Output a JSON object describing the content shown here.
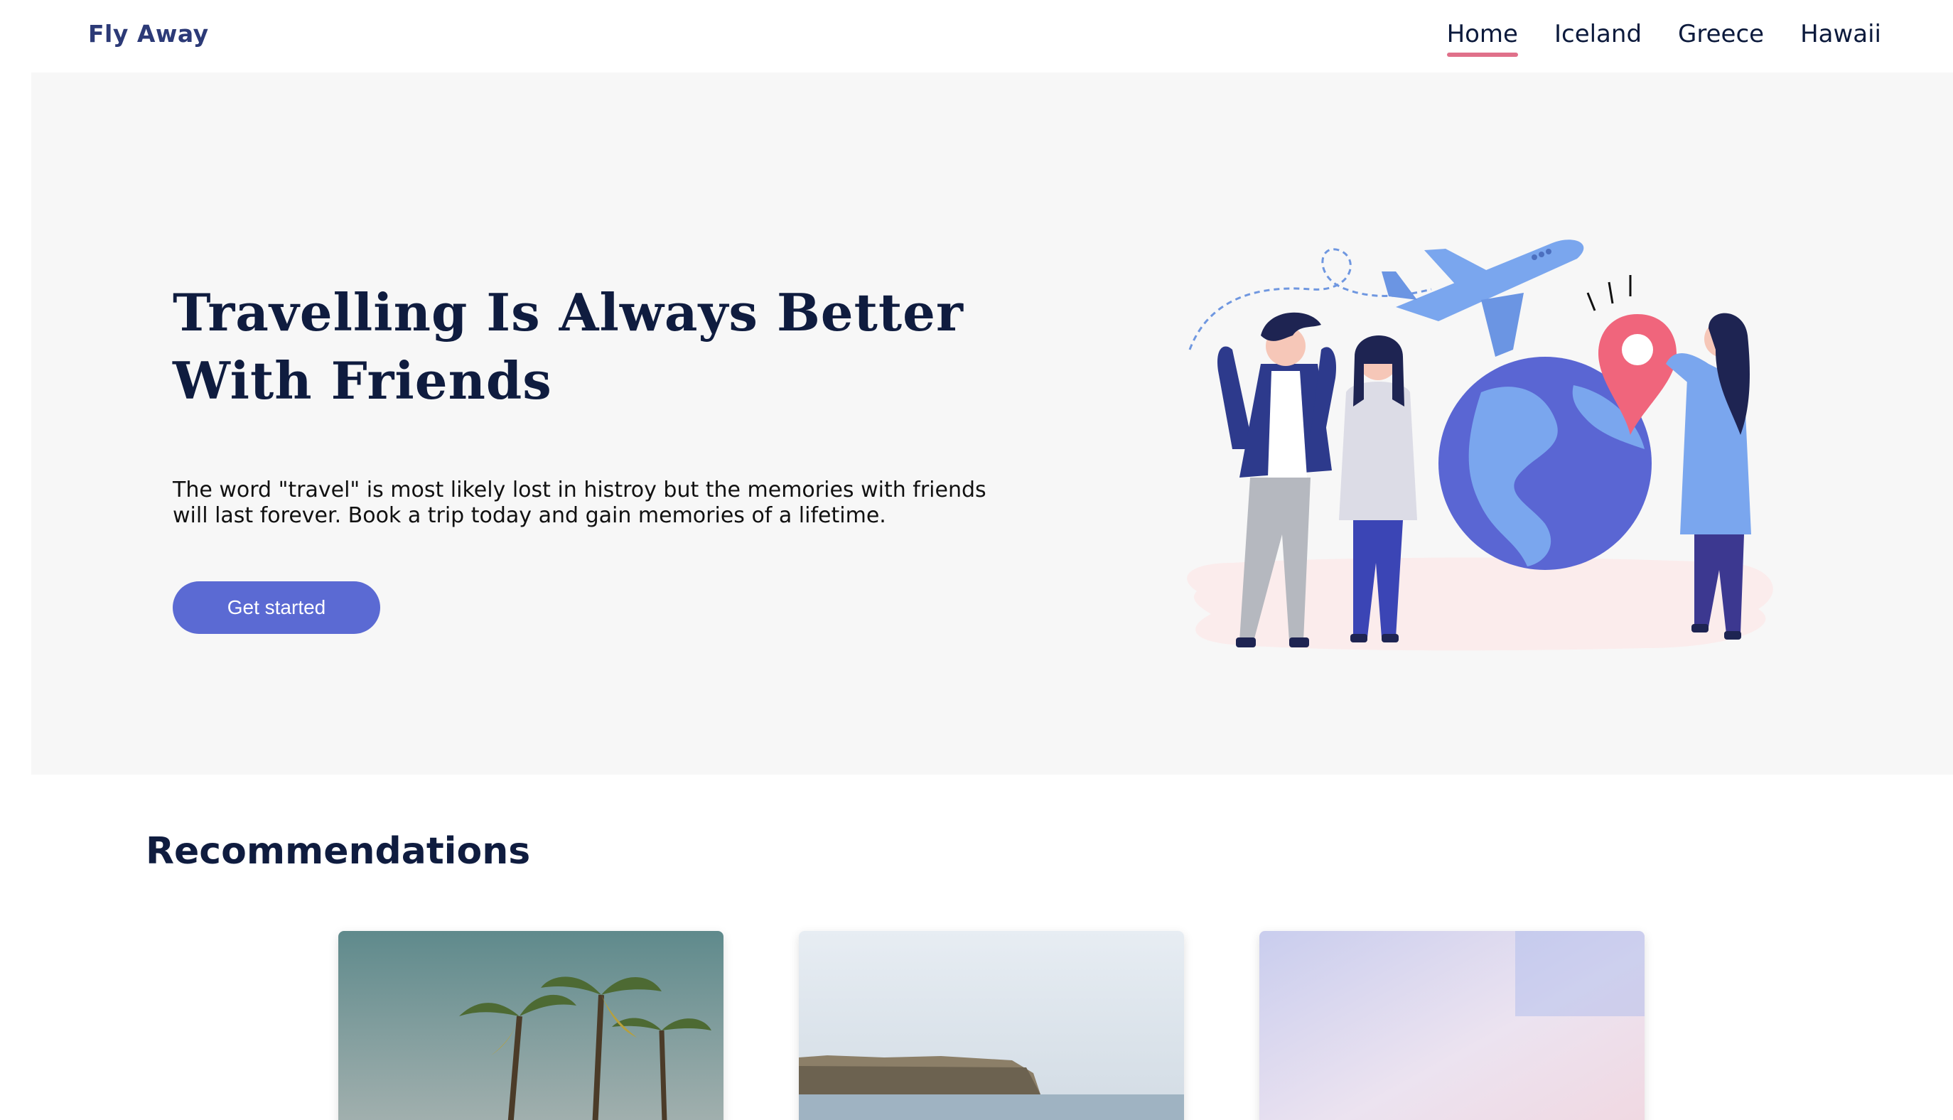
{
  "header": {
    "brand": "Fly Away",
    "nav": [
      {
        "label": "Home",
        "active": true
      },
      {
        "label": "Iceland",
        "active": false
      },
      {
        "label": "Greece",
        "active": false
      },
      {
        "label": "Hawaii",
        "active": false
      }
    ]
  },
  "hero": {
    "title": "Travelling Is Always Better With Friends",
    "description": "The word \"travel\" is most likely lost in histroy but the memories with friends will last forever. Book a trip today and gain memories of a lifetime.",
    "cta_label": "Get started",
    "illustration_icons": [
      "airplane-icon",
      "globe-icon",
      "location-pin-icon"
    ]
  },
  "recommendations": {
    "title": "Recommendations",
    "cards": [
      {
        "name": "palm-trees-photo"
      },
      {
        "name": "coastal-cliff-photo"
      },
      {
        "name": "pastel-sky-photo"
      }
    ]
  },
  "colors": {
    "brand": "#2c3a77",
    "accent": "#5b6ad3",
    "nav_underline": "#e0708a",
    "hero_bg": "#f7f7f7",
    "heading": "#0f1c3f"
  }
}
